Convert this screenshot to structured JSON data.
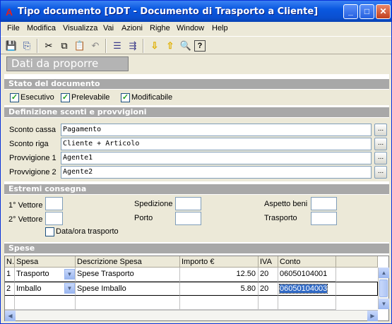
{
  "window": {
    "title": "Tipo documento [DDT - Documento di Trasporto a Cliente]",
    "app_icon": "A",
    "controls": {
      "minimize": "_",
      "maximize": "□",
      "close": "✕"
    }
  },
  "menubar": [
    "File",
    "Modifica",
    "Visualizza",
    "Vai",
    "Azioni",
    "Righe",
    "Window",
    "Help"
  ],
  "toolbar": {
    "icons": [
      "save-icon",
      "save-close-icon",
      "cut-icon",
      "copy-icon",
      "paste-icon",
      "undo-icon",
      "insert-row-icon",
      "append-row-icon",
      "arrow-down-icon",
      "arrow-up-icon",
      "zoom-icon",
      "help-icon"
    ]
  },
  "tab": {
    "label": "Dati da proporre"
  },
  "stato": {
    "title": "Stato del documento",
    "checks": [
      {
        "label": "Esecutivo",
        "checked": true
      },
      {
        "label": "Prelevabile",
        "checked": true
      },
      {
        "label": "Modificabile",
        "checked": true
      }
    ]
  },
  "sconti": {
    "title": "Definizione sconti e provvigioni",
    "rows": [
      {
        "label": "Sconto cassa",
        "value": "Pagamento",
        "button": "..."
      },
      {
        "label": "Sconto riga",
        "value": "Cliente + Articolo",
        "button": "..."
      },
      {
        "label": "Provvigione 1",
        "value": "Agente1",
        "button": "..."
      },
      {
        "label": "Provvigione 2",
        "value": "Agente2",
        "button": "..."
      }
    ]
  },
  "consegna": {
    "title": "Estremi consegna",
    "vettore1": "1° Vettore",
    "vettore2": "2° Vettore",
    "spedizione": "Spedizione",
    "porto": "Porto",
    "aspetto": "Aspetto beni",
    "trasporto": "Trasporto",
    "data_ora": {
      "label": "Data/ora trasporto",
      "checked": false
    }
  },
  "spese": {
    "title": "Spese",
    "columns": [
      "N.",
      "Spesa",
      "Descrizione Spesa",
      "Importo €",
      "IVA",
      "Conto"
    ],
    "rows": [
      {
        "n": "1",
        "spesa": "Trasporto",
        "descrizione": "Spese Trasporto",
        "importo": "12.50",
        "iva": "20",
        "conto": "06050104001"
      },
      {
        "n": "2",
        "spesa": "Imballo",
        "descrizione": "Spese Imballo",
        "importo": "5.80",
        "iva": "20",
        "conto": "06050104003"
      }
    ]
  }
}
